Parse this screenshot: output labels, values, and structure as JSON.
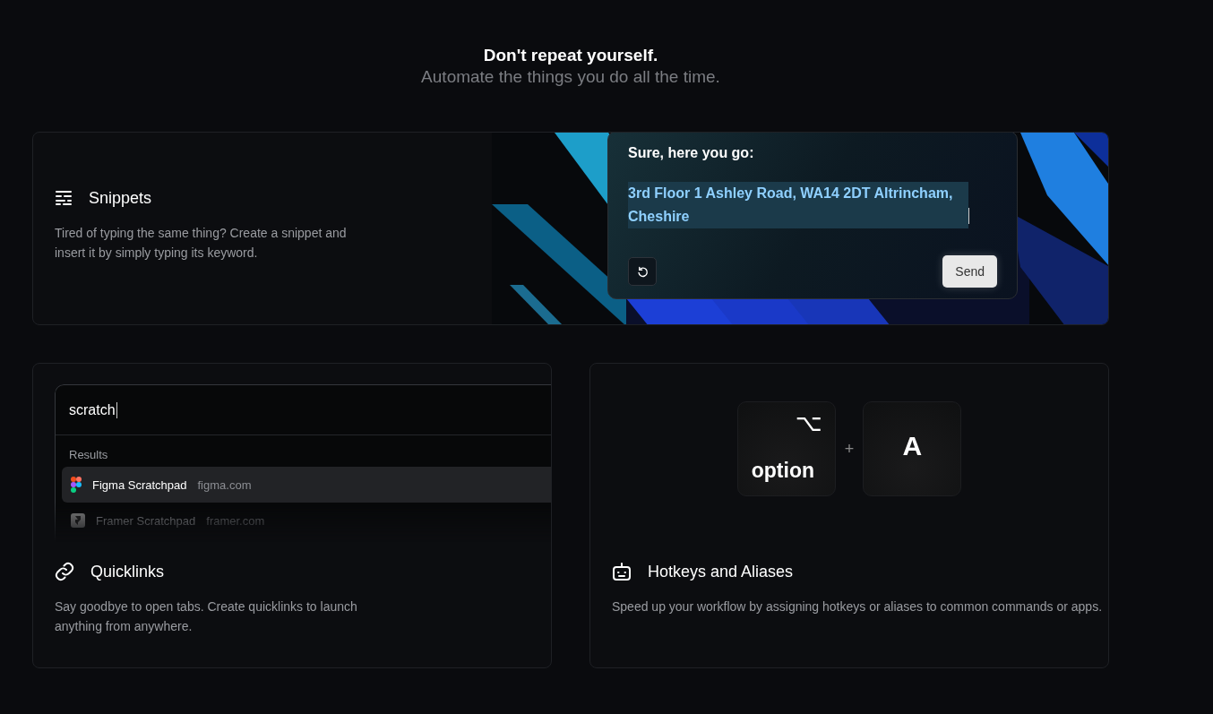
{
  "header": {
    "title": "Don't repeat yourself.",
    "subtitle": "Automate the things you do all the time."
  },
  "snippets": {
    "title": "Snippets",
    "description": "Tired of typing the same thing? Create a snippet and insert it by simply typing its keyword.",
    "chat": {
      "prompt": "Sure, here you go:",
      "reply": "3rd Floor 1 Ashley Road, WA14 2DT Altrincham, Cheshire",
      "highlighted": true,
      "button": "Send"
    }
  },
  "quicklinks": {
    "title": "Quicklinks",
    "description": "Say goodbye to open tabs. Create quicklinks to launch anything from anywhere.",
    "search": {
      "value": "scratch"
    },
    "section": "Results",
    "results": [
      {
        "kind": "figma",
        "name": "Figma Scratchpad",
        "url": "figma.com",
        "selected": true
      },
      {
        "kind": "framer",
        "name": "Framer Scratchpad",
        "url": "framer.com",
        "selected": false
      }
    ]
  },
  "hotkeys": {
    "title": "Hotkeys and Aliases",
    "description": "Speed up your workflow by assigning hotkeys or aliases to common commands or apps.",
    "keys": [
      {
        "kind": "modifier",
        "symbol": "⌥",
        "label": "option"
      },
      {
        "kind": "letter",
        "label": "A"
      }
    ],
    "joiner": "+"
  }
}
